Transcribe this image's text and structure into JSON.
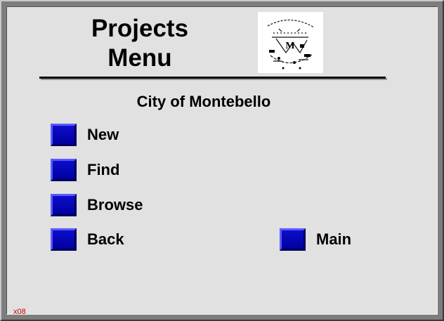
{
  "header": {
    "title_line1": "Projects",
    "title_line2": "Menu",
    "logo": {
      "text_top": "MONTEBELLO",
      "letter": "M",
      "description": "city seal"
    }
  },
  "subtitle": "City of Montebello",
  "menu": {
    "new_label": "New",
    "find_label": "Find",
    "browse_label": "Browse",
    "back_label": "Back",
    "main_label": "Main"
  },
  "footer": {
    "screen_code": "x08"
  },
  "colors": {
    "button_blue": "#0000a0",
    "panel_gray": "#e1e1e1",
    "code_red": "#cc0000"
  }
}
